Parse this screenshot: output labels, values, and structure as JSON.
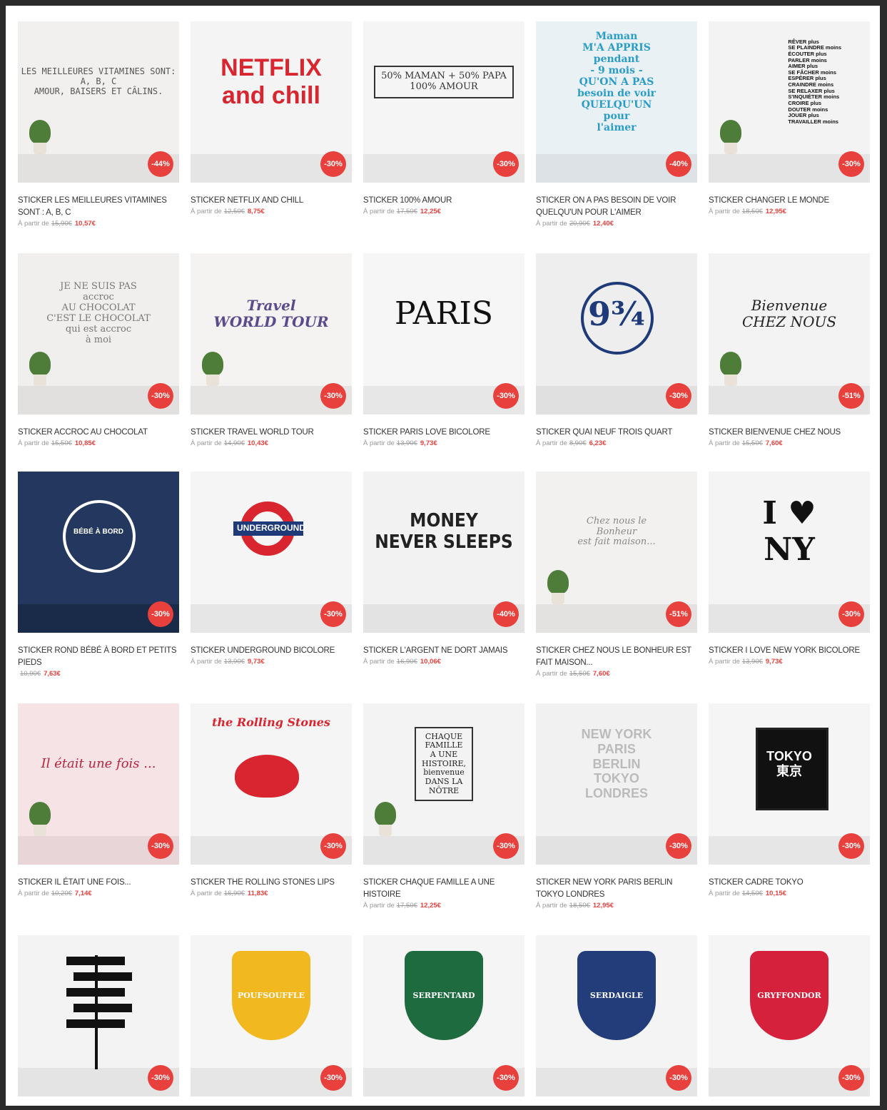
{
  "products": [
    {
      "title": "Sticker les meilleures vitamines sont : A, B, C",
      "prefix": "À partir de",
      "old_price": "15,90€",
      "new_price": "10,57€",
      "badge": "-44%",
      "art": "LES MEILLEURES VITAMINES SONT:\nA, B, C\nAMOUR, BAISERS ET CÂLINS.",
      "theme": "vitamines",
      "bg": "#f1f0ee"
    },
    {
      "title": "Sticker Netflix and chill",
      "prefix": "À partir de",
      "old_price": "12,50€",
      "new_price": "8,75€",
      "badge": "-30%",
      "art": "NETFLIX\nand chill",
      "theme": "netflix",
      "bg": "#f4f4f4"
    },
    {
      "title": "Sticker 100% Amour",
      "prefix": "À partir de",
      "old_price": "17,50€",
      "new_price": "12,25€",
      "badge": "-30%",
      "art": "50% MAMAN + 50% PAPA\n100% AMOUR",
      "theme": "amour",
      "bg": "#f5f5f5"
    },
    {
      "title": "Sticker on a pas besoin de voir quelqu'un pour l'aimer",
      "prefix": "À partir de",
      "old_price": "20,90€",
      "new_price": "12,40€",
      "badge": "-40%",
      "art": "Maman\nM'A APPRIS\npendant\n- 9 mois -\nQU'ON A PAS\nbesoin de voir\nQUELQU'UN\npour\nl'aimer",
      "theme": "maman",
      "bg": "#eaf1f5"
    },
    {
      "title": "Sticker changer le monde",
      "prefix": "À partir de",
      "old_price": "18,50€",
      "new_price": "12,95€",
      "badge": "-30%",
      "art": "RÊVER plus\nSE PLAINDRE moins\nÉCOUTER plus\nPARLER moins\nAIMER plus\nSE FÂCHER moins\nESPÉRER plus\nCRAINDRE moins\nSE RELAXER plus\nS'INQUIÉTER moins\nCROIRE plus\nDOUTER moins\nJOUER plus\nTRAVAILLER moins",
      "theme": "monde",
      "bg": "#f3f3f3"
    },
    {
      "title": "Sticker accroc au chocolat",
      "prefix": "À partir de",
      "old_price": "15,50€",
      "new_price": "10,85€",
      "badge": "-30%",
      "art": "JE NE SUIS PAS\naccroc\nAU CHOCOLAT\nC'EST LE CHOCOLAT\nqui est accroc\nà moi",
      "theme": "chocolat",
      "bg": "#f0efed"
    },
    {
      "title": "Sticker Travel World Tour",
      "prefix": "À partir de",
      "old_price": "14,90€",
      "new_price": "10,43€",
      "badge": "-30%",
      "art": "Travel\nWORLD TOUR",
      "theme": "travel",
      "bg": "#f4f3f2"
    },
    {
      "title": "Sticker Paris love bicolore",
      "prefix": "À partir de",
      "old_price": "13,90€",
      "new_price": "9,73€",
      "badge": "-30%",
      "art": "PARIS",
      "theme": "paris",
      "bg": "#f6f6f6"
    },
    {
      "title": "Sticker Quai neuf trois quart",
      "prefix": "À partir de",
      "old_price": "8,90€",
      "new_price": "6,23€",
      "badge": "-30%",
      "art": "9¾",
      "theme": "quai",
      "bg": "#eeeeee"
    },
    {
      "title": "Sticker bienvenue chez nous",
      "prefix": "À partir de",
      "old_price": "15,50€",
      "new_price": "7,60€",
      "badge": "-51%",
      "art": "Bienvenue\nCHEZ NOUS",
      "theme": "bienvenue",
      "bg": "#f3f3f3"
    },
    {
      "title": "Sticker rond bébé à bord et petits pieds",
      "prefix": "",
      "old_price": "10,90€",
      "new_price": "7,63€",
      "badge": "-30%",
      "art": "BÉBÉ À BORD",
      "theme": "bebe",
      "bg": "#24385f"
    },
    {
      "title": "Sticker Underground bicolore",
      "prefix": "À partir de",
      "old_price": "13,90€",
      "new_price": "9,73€",
      "badge": "-30%",
      "art": "UNDERGROUND",
      "theme": "underground",
      "bg": "#f5f5f5"
    },
    {
      "title": "Sticker l'argent ne dort jamais",
      "prefix": "À partir de",
      "old_price": "16,90€",
      "new_price": "10,06€",
      "badge": "-40%",
      "art": "MONEY\nNEVER SLEEPS",
      "theme": "money",
      "bg": "#f2f2f2"
    },
    {
      "title": "Sticker chez nous le bonheur est fait maison...",
      "prefix": "À partir de",
      "old_price": "15,50€",
      "new_price": "7,60€",
      "badge": "-51%",
      "art": "Chez nous le\nBonheur\nest fait maison...",
      "theme": "bonheur",
      "bg": "#f2f1ef"
    },
    {
      "title": "Sticker I love New York bicolore",
      "prefix": "À partir de",
      "old_price": "13,90€",
      "new_price": "9,73€",
      "badge": "-30%",
      "art": "I ♥\nNY",
      "theme": "ny",
      "bg": "#f4f4f4"
    },
    {
      "title": "Sticker il était une fois...",
      "prefix": "À partir de",
      "old_price": "10,20€",
      "new_price": "7,14€",
      "badge": "-30%",
      "art": "Il était une fois ...",
      "theme": "fois",
      "bg": "#f6e3e6"
    },
    {
      "title": "Sticker the Rolling Stones lips",
      "prefix": "À partir de",
      "old_price": "16,90€",
      "new_price": "11,83€",
      "badge": "-30%",
      "art": "the Rolling Stones",
      "theme": "stones",
      "bg": "#f5f5f5"
    },
    {
      "title": "Sticker chaque famille a une histoire",
      "prefix": "À partir de",
      "old_price": "17,50€",
      "new_price": "12,25€",
      "badge": "-30%",
      "art": "CHAQUE\nFAMILLE\nA UNE\nHISTOIRE,\nbienvenue\nDANS LA\nNÔTRE",
      "theme": "famille",
      "bg": "#f3f3f3"
    },
    {
      "title": "Sticker New York Paris Berlin Tokyo Londres",
      "prefix": "À partir de",
      "old_price": "18,50€",
      "new_price": "12,95€",
      "badge": "-30%",
      "art": "NEW YORK\nPARIS\nBERLIN\nTOKYO\nLONDRES",
      "theme": "villes",
      "bg": "#f1f1f1"
    },
    {
      "title": "Sticker cadre Tokyo",
      "prefix": "À partir de",
      "old_price": "14,50€",
      "new_price": "10,15€",
      "badge": "-30%",
      "art": "TOKYO\n東京",
      "theme": "tokyo",
      "bg": "#f5f5f5"
    },
    {
      "title": "",
      "prefix": "",
      "old_price": "",
      "new_price": "",
      "badge": "-30%",
      "art": "",
      "theme": "panneau",
      "bg": "#f3f3f3"
    },
    {
      "title": "",
      "prefix": "",
      "old_price": "",
      "new_price": "",
      "badge": "-30%",
      "art": "POUFSOUFFLE",
      "theme": "poufsouffle",
      "bg": "#f5f5f5"
    },
    {
      "title": "",
      "prefix": "",
      "old_price": "",
      "new_price": "",
      "badge": "-30%",
      "art": "SERPENTARD",
      "theme": "serpentard",
      "bg": "#f5f5f5"
    },
    {
      "title": "",
      "prefix": "",
      "old_price": "",
      "new_price": "",
      "badge": "-30%",
      "art": "SERDAIGLE",
      "theme": "serdaigle",
      "bg": "#f4f4f4"
    },
    {
      "title": "",
      "prefix": "",
      "old_price": "",
      "new_price": "",
      "badge": "-30%",
      "art": "GRYFFONDOR",
      "theme": "gryffondor",
      "bg": "#f5f5f5"
    }
  ],
  "colors": {
    "accent": "#e8413d",
    "text": "#333333",
    "muted": "#999999"
  }
}
